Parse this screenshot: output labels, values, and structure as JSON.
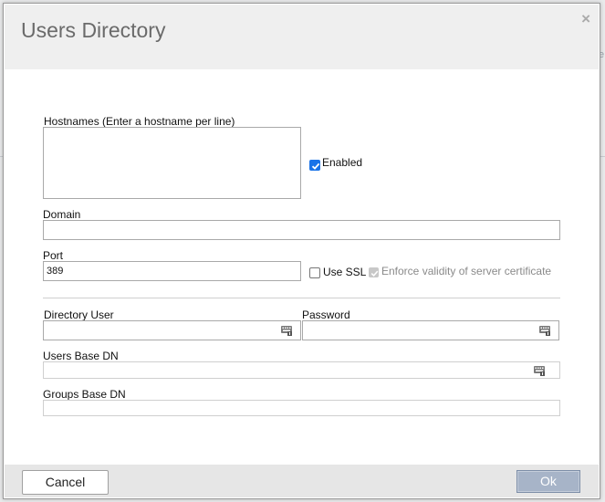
{
  "dialog": {
    "title": "Users Directory",
    "close_glyph": "×"
  },
  "form": {
    "hostnames_label": "Hostnames (Enter a hostname per line)",
    "hostnames_value": "",
    "enabled_label": "Enabled",
    "enabled_checked": true,
    "domain_label": "Domain",
    "domain_value": "",
    "port_label": "Port",
    "port_value": "389",
    "use_ssl_label": "Use SSL",
    "use_ssl_checked": false,
    "enforce_label": "Enforce validity of server certificate",
    "enforce_checked": true,
    "enforce_disabled": true,
    "directory_user_label": "Directory User",
    "directory_user_value": "",
    "password_label": "Password",
    "password_value": "",
    "users_base_dn_label": "Users Base DN",
    "users_base_dn_value": "",
    "groups_base_dn_label": "Groups Base DN",
    "groups_base_dn_value": ""
  },
  "icons": {
    "field_icon": "keyboard-icon",
    "close": "close-icon",
    "check": "checkmark-icon"
  },
  "footer": {
    "cancel_label": "Cancel",
    "ok_label": "Ok"
  },
  "colors": {
    "checkbox_accent": "#1a73e8",
    "ok_button": "#a7b4c8",
    "title_text": "#6a6a6a"
  }
}
